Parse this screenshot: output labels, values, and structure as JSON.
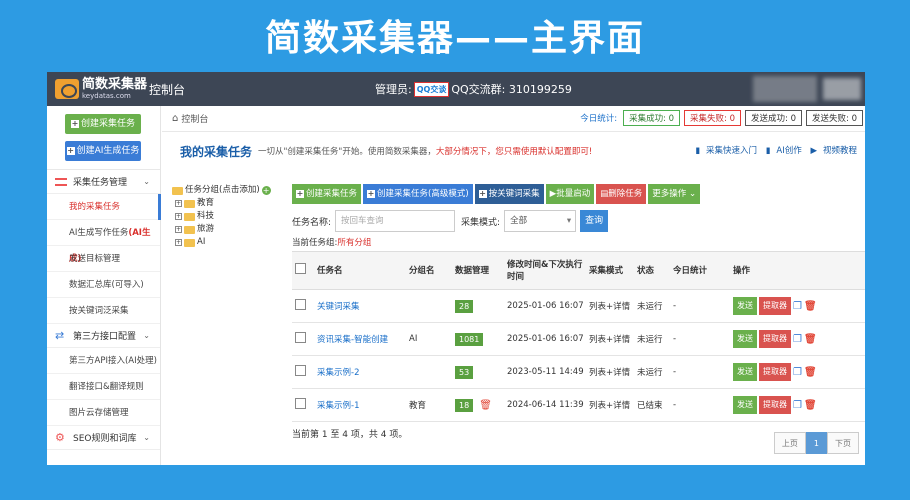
{
  "banner": "简数采集器——主界面",
  "topbar": {
    "logo_name": "简数采集器",
    "logo_domain": "keydatas.com",
    "title": "控制台",
    "admin_label": "管理员:",
    "qq_badge": "QQ交谈",
    "qq_group": "QQ交流群: 310199259"
  },
  "sidebar": {
    "create_task": "创建采集任务",
    "create_ai_task": "创建AI生成任务",
    "groups": [
      {
        "label": "采集任务管理",
        "items": [
          "我的采集任务",
          "AI生成写作任务",
          "发送目标管理",
          "数据汇总库(可导入)",
          "按关键词泛采集"
        ]
      },
      {
        "label": "第三方接口配置",
        "items": [
          "第三方API接入(AI处理)",
          "翻译接口&翻译规则",
          "图片云存储管理"
        ]
      },
      {
        "label": "SEO规则和词库"
      }
    ],
    "ai_badge": "(AI生成)"
  },
  "main": {
    "crumb": "控制台",
    "stats_title": "今日统计:",
    "stats": [
      "采集成功: 0",
      "采集失败: 0",
      "发送成功: 0",
      "发送失败: 0"
    ],
    "heading": "我的采集任务",
    "desc_pre": "一切从\"创建采集任务\"开始。使用简数采集器，",
    "desc_hl": "大部分情况下，您只需使用默认配置即可!",
    "help": [
      "采集快速入门",
      "AI创作",
      "视频教程"
    ]
  },
  "tree": {
    "root": "任务分组(点击添加)",
    "nodes": [
      "教育",
      "科技",
      "旅游",
      "AI"
    ]
  },
  "toolbar": [
    "创建采集任务",
    "创建采集任务(高级模式)",
    "按关键词采集",
    "批量启动",
    "删除任务",
    "更多操作 ⌄"
  ],
  "search": {
    "name_label": "任务名称:",
    "placeholder": "按回车查询",
    "mode_label": "采集模式:",
    "mode_value": "全部",
    "button": "查询"
  },
  "current_group_label": "当前任务组:",
  "current_group_value": "所有分组",
  "table": {
    "headers": [
      "任务名",
      "分组名",
      "数据管理",
      "修改时间&下次执行时间",
      "采集模式",
      "状态",
      "今日统计",
      "操作"
    ],
    "rows": [
      {
        "name": "关键词采集",
        "group": "",
        "count": "28",
        "time": "2025-01-06 16:07",
        "mode": "列表+详情",
        "status": "未运行",
        "stat": "-"
      },
      {
        "name": "资讯采集-智能创建",
        "group": "AI",
        "count": "1081",
        "time": "2025-01-06 16:07",
        "mode": "列表+详情",
        "status": "未运行",
        "stat": "-"
      },
      {
        "name": "采集示例-2",
        "group": "",
        "count": "53",
        "time": "2023-05-11 14:49",
        "mode": "列表+详情",
        "status": "未运行",
        "stat": "-"
      },
      {
        "name": "采集示例-1",
        "group": "教育",
        "count": "18",
        "time": "2024-06-14 11:39",
        "mode": "列表+详情",
        "status": "已结束",
        "stat": "-"
      }
    ],
    "send": "发送",
    "fetch": "提取器"
  },
  "footer": "当前第 1 至 4 项，共 4 项。",
  "pager": {
    "prev": "上页",
    "page": "1",
    "next": "下页"
  }
}
